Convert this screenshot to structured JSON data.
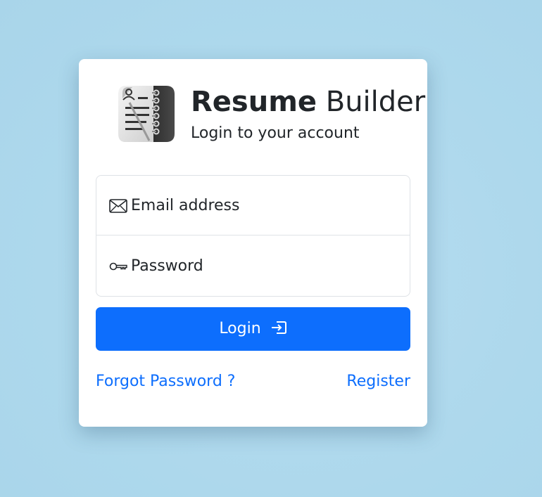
{
  "brand": {
    "title_bold": "Resume",
    "title_light": "Builder",
    "subtitle": "Login to your account",
    "logo_icon": "resume-notebook-icon"
  },
  "form": {
    "email": {
      "label": "Email address",
      "icon": "envelope-icon"
    },
    "password": {
      "label": "Password",
      "icon": "key-icon"
    },
    "login_label": "Login",
    "login_icon": "box-arrow-in-right-icon"
  },
  "links": {
    "forgot": "Forgot Password ?",
    "register": "Register"
  },
  "colors": {
    "background": "#add8ec",
    "primary": "#0d6efd",
    "text": "#212529",
    "border": "#dee2e6"
  }
}
